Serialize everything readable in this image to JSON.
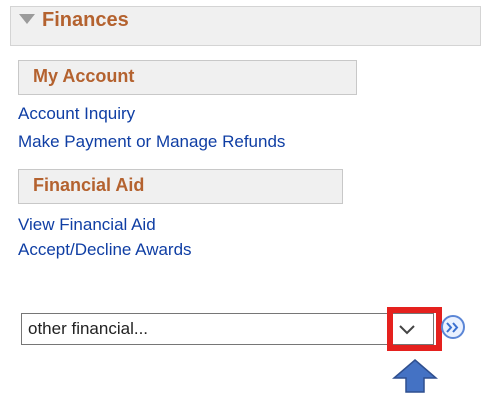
{
  "header": {
    "title": "Finances",
    "icon": "collapse-triangle-icon"
  },
  "sections": [
    {
      "title": "My Account",
      "links": [
        "Account Inquiry",
        "Make Payment or Manage Refunds"
      ]
    },
    {
      "title": "Financial Aid",
      "links": [
        "View Financial Aid",
        "Accept/Decline Awards"
      ]
    }
  ],
  "dropdown": {
    "value": "other financial...",
    "icon": "chevron-down-icon"
  },
  "go_button": {
    "icon": "double-chevron-right-icon"
  },
  "annotation": {
    "highlight_color": "#e5211e",
    "arrow_color": "#4472c4"
  },
  "colors": {
    "heading": "#b4622f",
    "link": "#0f3ea4",
    "panel": "#f0f0f0"
  }
}
